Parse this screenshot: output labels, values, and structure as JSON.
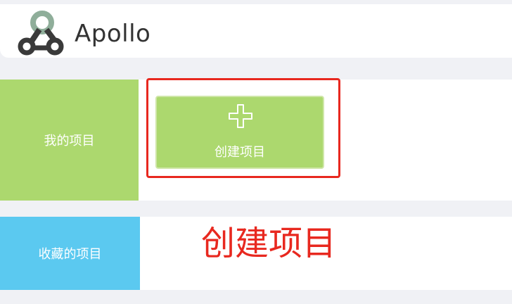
{
  "brand": {
    "name": "Apollo"
  },
  "sections": {
    "my_projects": {
      "label": "我的项目"
    },
    "favorites": {
      "label": "收藏的项目"
    }
  },
  "create_button": {
    "label": "创建项目",
    "icon": "plus-icon"
  },
  "annotation": {
    "text": "创建项目"
  },
  "colors": {
    "my_projects_bg": "#acd86e",
    "favorites_bg": "#5bc9f0",
    "highlight": "#e8281f",
    "page_bg": "#f0f1f5"
  }
}
